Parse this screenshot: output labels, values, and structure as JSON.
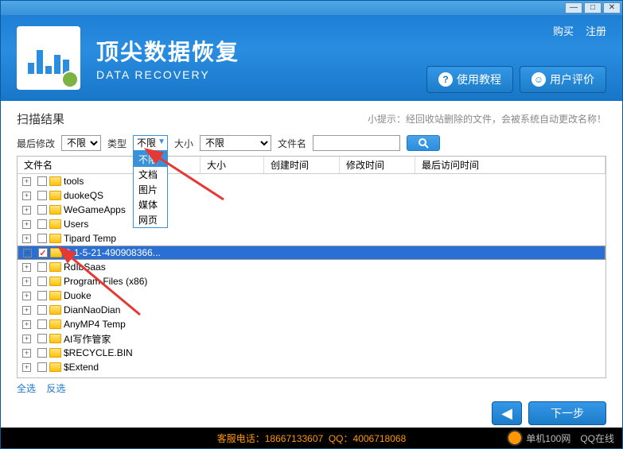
{
  "app": {
    "title_cn": "顶尖数据恢复",
    "title_en": "DATA RECOVERY"
  },
  "top_links": {
    "buy": "购买",
    "register": "注册"
  },
  "header_buttons": {
    "tutorial": "使用教程",
    "review": "用户评价"
  },
  "result": {
    "title": "扫描结果",
    "hint": "小提示：经回收站删除的文件，会被系统自动更改名称！"
  },
  "filters": {
    "last_modified_label": "最后修改",
    "last_modified_value": "不限",
    "type_label": "类型",
    "type_value": "不限",
    "type_options": [
      "不限",
      "文档",
      "图片",
      "媒体",
      "网页"
    ],
    "size_label": "大小",
    "size_value": "不限",
    "filename_label": "文件名",
    "filename_value": ""
  },
  "columns": {
    "name": "文件名",
    "size": "大小",
    "created": "创建时间",
    "modified": "修改时间",
    "accessed": "最后访问时间"
  },
  "tree": [
    {
      "name": "tools",
      "checked": false
    },
    {
      "name": "duokeQS",
      "checked": false
    },
    {
      "name": "WeGameApps",
      "checked": false
    },
    {
      "name": "Users",
      "checked": false
    },
    {
      "name": "Tipard Temp",
      "checked": false
    },
    {
      "name": "S-1-5-21-490908366...",
      "checked": true,
      "selected": true
    },
    {
      "name": "RdIbSaas",
      "checked": false
    },
    {
      "name": "Program Files (x86)",
      "checked": false
    },
    {
      "name": "Duoke",
      "checked": false
    },
    {
      "name": "DianNaoDian",
      "checked": false
    },
    {
      "name": "AnyMP4 Temp",
      "checked": false
    },
    {
      "name": "AI写作管家",
      "checked": false
    },
    {
      "name": "$RECYCLE.BIN",
      "checked": false
    },
    {
      "name": "$Extend",
      "checked": false
    }
  ],
  "select_links": {
    "all": "全选",
    "invert": "反选"
  },
  "nav": {
    "next": "下一步"
  },
  "footer": {
    "phone_label": "客服电话：",
    "phone": "18667133607",
    "qq_label": "QQ：",
    "qq": "4006718068",
    "watermark": "单机100网",
    "qq_status": "QQ在线"
  }
}
